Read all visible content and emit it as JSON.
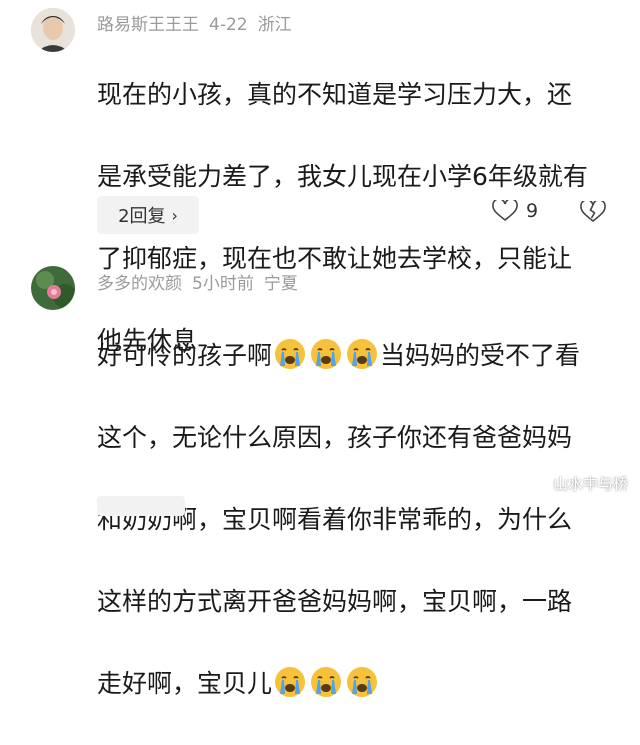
{
  "comment1": {
    "username": "路易斯王王王",
    "date": "4-22",
    "location": "浙江",
    "lines": [
      "现在的小孩，真的不知道是学习压力大，还",
      "是承受能力差了，我女儿现在小学6年级就有",
      "了抑郁症，现在也不敢让她去学校，只能让",
      "他先休息"
    ],
    "reply_label": "2回复",
    "like_count": "9"
  },
  "comment2": {
    "username": "多多的欢颜",
    "time": "5小时前",
    "location": "宁夏",
    "line1": "好可怜的孩子啊",
    "line1_tail": "当妈妈的受不了看",
    "line2": "这个，无论什么原因，孩子你还有爸爸妈妈",
    "line3": "和奶奶啊，宝贝啊看着你非常乖的，为什么",
    "line4": "这样的方式离开爸爸妈妈啊，宝贝啊，一路",
    "line5": "走好啊，宝贝儿"
  },
  "watermark": "山水中与桥",
  "colors": {
    "meta": "#9a9a9a",
    "text": "#1a1a1a",
    "button_bg": "#f2f2f2"
  },
  "icons": [
    "crying-emoji-icon",
    "heart-icon",
    "broken-heart-icon",
    "chevron-right-icon"
  ]
}
